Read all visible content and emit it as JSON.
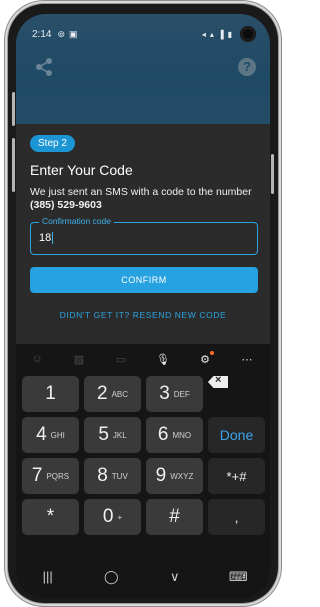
{
  "status_bar": {
    "time": "2:14"
  },
  "header": {
    "help_label": "?"
  },
  "card": {
    "step_label": "Step 2",
    "title": "Enter Your Code",
    "description": "We just sent an SMS with a code to the number",
    "phone_number": "(385) 529-9603",
    "field_label": "Confirmation code",
    "field_value": "18",
    "confirm_label": "CONFIRM",
    "resend_label": "DIDN'T GET IT? RESEND NEW CODE"
  },
  "keyboard": {
    "rows": [
      [
        {
          "main": "1",
          "sub": ""
        },
        {
          "main": "2",
          "sub": "ABC"
        },
        {
          "main": "3",
          "sub": "DEF"
        },
        {
          "main": "",
          "sub": "",
          "type": "backspace"
        }
      ],
      [
        {
          "main": "4",
          "sub": "GHI"
        },
        {
          "main": "5",
          "sub": "JKL"
        },
        {
          "main": "6",
          "sub": "MNO"
        },
        {
          "main": "Done",
          "sub": "",
          "type": "done"
        }
      ],
      [
        {
          "main": "7",
          "sub": "PQRS"
        },
        {
          "main": "8",
          "sub": "TUV"
        },
        {
          "main": "9",
          "sub": "WXYZ"
        },
        {
          "main": "*+#",
          "sub": "",
          "type": "dark"
        }
      ],
      [
        {
          "main": "*",
          "sub": ""
        },
        {
          "main": "0",
          "sub": "+"
        },
        {
          "main": "#",
          "sub": ""
        },
        {
          "main": ",",
          "sub": "",
          "type": "dark"
        }
      ]
    ]
  },
  "colors": {
    "accent": "#27a2e1",
    "header": "#1f4a66",
    "card": "#2b2b2b"
  }
}
